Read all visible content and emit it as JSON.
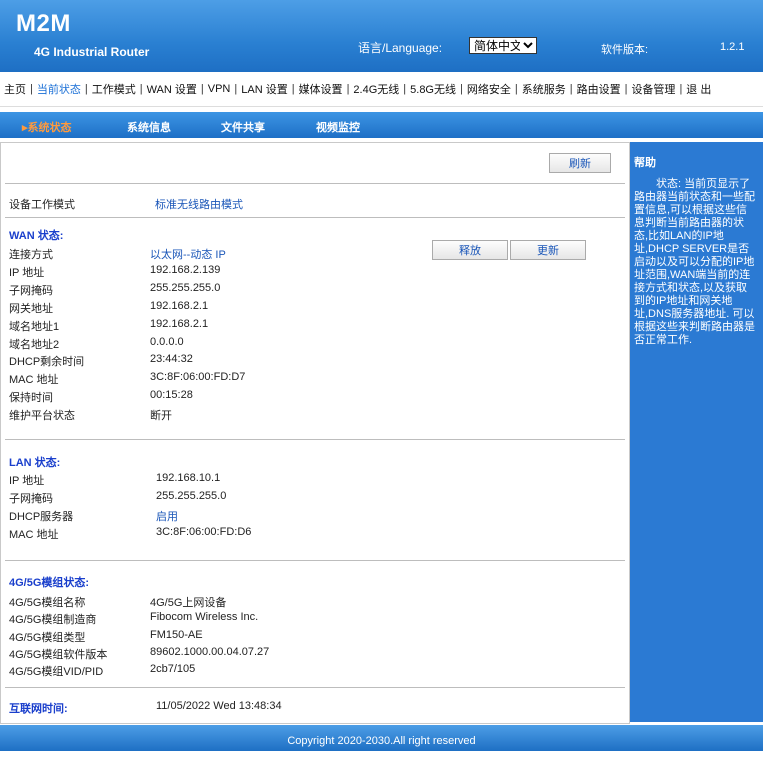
{
  "header": {
    "logo": "M2M",
    "subtitle": "4G Industrial Router",
    "language_label": "语言/Language:",
    "language_selected": "简体中文",
    "version_label": "软件版本:",
    "version_value": "1.2.1"
  },
  "menu": {
    "items": [
      "主页",
      "当前状态",
      "工作模式",
      "WAN 设置",
      "VPN",
      "LAN 设置",
      "媒体设置",
      "2.4G无线",
      "5.8G无线",
      "网络安全",
      "系统服务",
      "路由设置",
      "设备管理",
      "退 出"
    ],
    "active_index": 1
  },
  "subnav": {
    "items": [
      "▸系统状态",
      "系统信息",
      "文件共享",
      "视频监控"
    ],
    "active_index": 0
  },
  "status": {
    "refresh_button": "刷新",
    "mode_label": "设备工作模式",
    "mode_value": "标准无线路由模式",
    "wan": {
      "title": "WAN 状态:",
      "release_button": "释放",
      "renew_button": "更新",
      "rows": [
        {
          "label": "连接方式",
          "value": "以太网--动态 IP"
        },
        {
          "label": "IP 地址",
          "value": "192.168.2.139"
        },
        {
          "label": "子网掩码",
          "value": "255.255.255.0"
        },
        {
          "label": "网关地址",
          "value": "192.168.2.1"
        },
        {
          "label": "域名地址1",
          "value": "192.168.2.1"
        },
        {
          "label": "域名地址2",
          "value": "0.0.0.0"
        },
        {
          "label": "DHCP剩余时间",
          "value": "23:44:32"
        },
        {
          "label": "MAC 地址",
          "value": "3C:8F:06:00:FD:D7"
        },
        {
          "label": "保持时间",
          "value": "00:15:28"
        },
        {
          "label": "维护平台状态",
          "value": "断开"
        }
      ]
    },
    "lan": {
      "title": "LAN 状态:",
      "rows": [
        {
          "label": "IP 地址",
          "value": "192.168.10.1"
        },
        {
          "label": "子网掩码",
          "value": "255.255.255.0"
        },
        {
          "label": "DHCP服务器",
          "value": "启用"
        },
        {
          "label": "MAC 地址",
          "value": "3C:8F:06:00:FD:D6"
        }
      ]
    },
    "module": {
      "title": "4G/5G模组状态:",
      "rows": [
        {
          "label": "4G/5G模组名称",
          "value": "4G/5G上网设备"
        },
        {
          "label": "4G/5G模组制造商",
          "value": "Fibocom Wireless Inc."
        },
        {
          "label": "4G/5G模组类型",
          "value": "FM150-AE"
        },
        {
          "label": "4G/5G模组软件版本",
          "value": "89602.1000.00.04.07.27"
        },
        {
          "label": "4G/5G模组VID/PID",
          "value": "2cb7/105"
        }
      ]
    },
    "internet_time_label": "互联网时间:",
    "internet_time_value": "11/05/2022 Wed 13:48:34"
  },
  "help": {
    "title": "帮助",
    "text": "状态: 当前页显示了路由器当前状态和一些配置信息,可以根据这些信息判断当前路由器的状态,比如LAN的IP地址,DHCP SERVER是否启动以及可以分配的IP地址范围,WAN端当前的连接方式和状态,以及获取到的IP地址和网关地址,DNS服务器地址. 可以根据这些来判断路由器是否正常工作."
  },
  "footer": {
    "copyright": "Copyright 2020-2030.All right reserved"
  }
}
